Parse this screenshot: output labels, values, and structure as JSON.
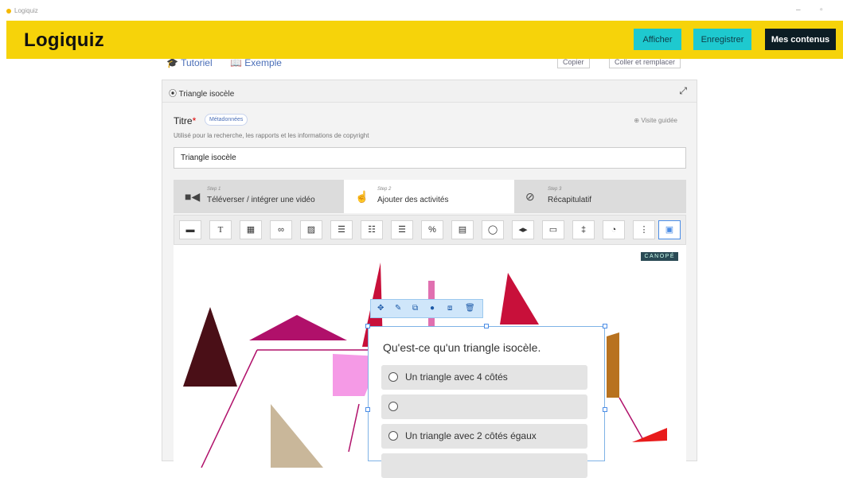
{
  "window": {
    "title": "Logiquiz",
    "minimize": "–",
    "maximize": "▫"
  },
  "header": {
    "logo": "Logiquiz",
    "buttons": {
      "afficher": "Afficher",
      "enregistrer": "Enregistrer",
      "mes_contenus": "Mes contenus"
    }
  },
  "top_links": {
    "tutoriel": "Tutoriel",
    "exemple": "Exemple",
    "copier": "Copier",
    "coller": "Coller et remplacer"
  },
  "editor": {
    "header_label": "Triangle isocèle",
    "title_label": "Titre",
    "required_mark": "*",
    "metadata_button": "Métadonnées",
    "guide_link": "Visite guidée",
    "description": "Utilisé pour la recherche, les rapports et les informations de copyright",
    "title_value": "Triangle isocèle"
  },
  "steps": [
    {
      "number": "Step 1",
      "label": "Téléverser / intégrer une vidéo",
      "icon": "video-icon"
    },
    {
      "number": "Step 2",
      "label": "Ajouter des activités",
      "icon": "touch-icon"
    },
    {
      "number": "Step 3",
      "label": "Récapitulatif",
      "icon": "check-circle-icon"
    }
  ],
  "canvas": {
    "watermark": "CANOPÉ"
  },
  "question": {
    "text": "Qu'est-ce qu'un triangle isocèle.",
    "answers": [
      "Un triangle avec 4 côtés",
      "",
      "Un triangle avec 2 côtés égaux"
    ]
  },
  "colors": {
    "accent": "#f6d30a",
    "cyan": "#1ec9cf",
    "dark": "#0c1d24",
    "selection": "#4b8de6"
  }
}
